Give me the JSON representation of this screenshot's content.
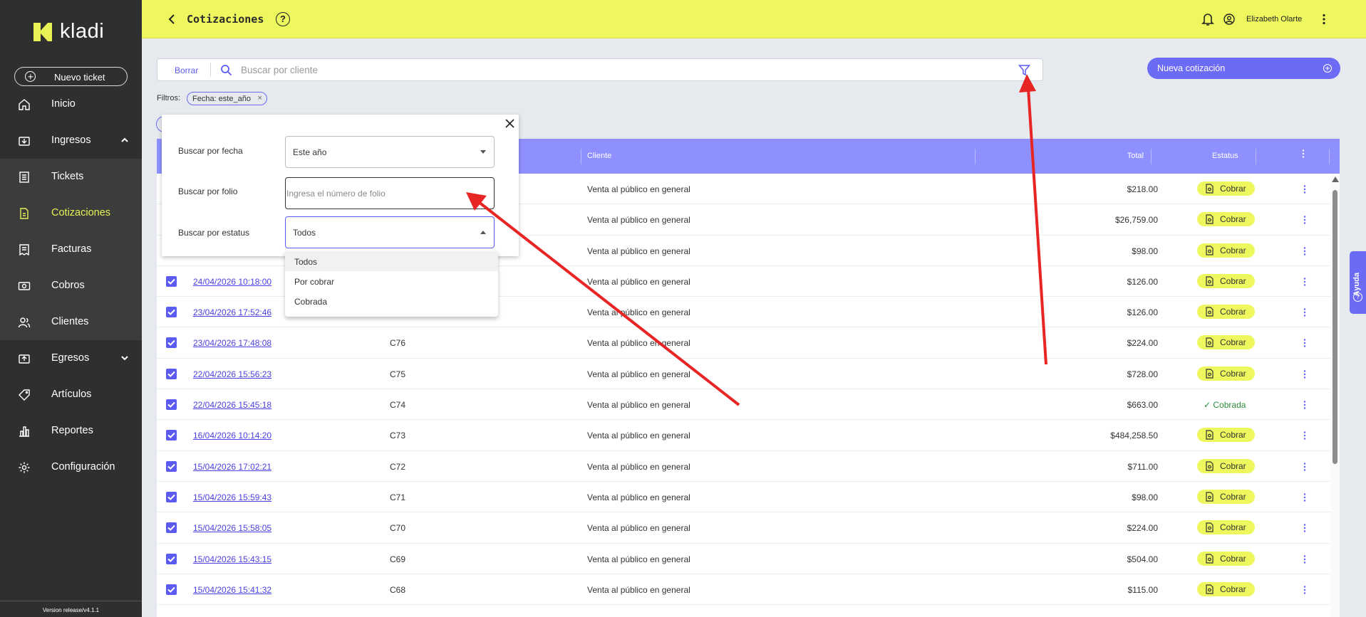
{
  "sidebar": {
    "logo_text": "kladi",
    "new_ticket_label": "Nuevo ticket",
    "items": [
      {
        "label": "Inicio",
        "icon": "home-icon"
      },
      {
        "label": "Ingresos",
        "icon": "income-icon",
        "expanded": true
      },
      {
        "label": "Tickets",
        "icon": "ticket-icon"
      },
      {
        "label": "Cotizaciones",
        "icon": "quote-icon",
        "active": true
      },
      {
        "label": "Facturas",
        "icon": "invoice-icon"
      },
      {
        "label": "Cobros",
        "icon": "money-icon"
      },
      {
        "label": "Clientes",
        "icon": "users-icon"
      },
      {
        "label": "Egresos",
        "icon": "expense-icon",
        "expanded": false
      },
      {
        "label": "Artículos",
        "icon": "tag-icon"
      },
      {
        "label": "Reportes",
        "icon": "chart-icon"
      },
      {
        "label": "Configuración",
        "icon": "gear-icon"
      }
    ],
    "version": "Version release/v4.1.1"
  },
  "header": {
    "title": "Cotizaciones",
    "help_glyph": "?",
    "user_name": "Elizabeth Olarte"
  },
  "search": {
    "clear_label": "Borrar",
    "placeholder": "Buscar por cliente"
  },
  "new_quote_label": "Nueva cotización",
  "filters": {
    "label": "Filtros:",
    "chips": [
      "Fecha: este_año"
    ],
    "chip_remove": "×"
  },
  "table": {
    "columns": {
      "client": "Cliente",
      "total": "Total",
      "status": "Estatus"
    },
    "rows": [
      {
        "date": "",
        "folio": "",
        "client": "Venta al público en general",
        "total": "$218.00",
        "status": "Cobrar"
      },
      {
        "date": "",
        "folio": "",
        "client": "Venta al público en general",
        "total": "$26,759.00",
        "status": "Cobrar"
      },
      {
        "date": "",
        "folio": "",
        "client": "Venta al público en general",
        "total": "$98.00",
        "status": "Cobrar"
      },
      {
        "date": "24/04/2026  10:18:00",
        "folio": "",
        "client": "Venta al público en general",
        "total": "$126.00",
        "status": "Cobrar"
      },
      {
        "date": "23/04/2026  17:52:46",
        "folio": "",
        "client": "Venta al público en general",
        "total": "$126.00",
        "status": "Cobrar"
      },
      {
        "date": "23/04/2026  17:48:08",
        "folio": "C76",
        "client": "Venta al público en general",
        "total": "$224.00",
        "status": "Cobrar"
      },
      {
        "date": "22/04/2026  15:56:23",
        "folio": "C75",
        "client": "Venta al público en general",
        "total": "$728.00",
        "status": "Cobrar"
      },
      {
        "date": "22/04/2026  15:45:18",
        "folio": "C74",
        "client": "Venta al público en general",
        "total": "$663.00",
        "status": "Cobrada"
      },
      {
        "date": "16/04/2026  10:14:20",
        "folio": "C73",
        "client": "Venta al público en general",
        "total": "$484,258.50",
        "status": "Cobrar"
      },
      {
        "date": "15/04/2026  17:02:21",
        "folio": "C72",
        "client": "Venta al público en general",
        "total": "$711.00",
        "status": "Cobrar"
      },
      {
        "date": "15/04/2026  15:59:43",
        "folio": "C71",
        "client": "Venta al público en general",
        "total": "$98.00",
        "status": "Cobrar"
      },
      {
        "date": "15/04/2026  15:58:05",
        "folio": "C70",
        "client": "Venta al público en general",
        "total": "$224.00",
        "status": "Cobrar"
      },
      {
        "date": "15/04/2026  15:43:15",
        "folio": "C69",
        "client": "Venta al público en general",
        "total": "$504.00",
        "status": "Cobrar"
      },
      {
        "date": "15/04/2026  15:41:32",
        "folio": "C68",
        "client": "Venta al público en general",
        "total": "$115.00",
        "status": "Cobrar"
      }
    ]
  },
  "filter_popup": {
    "date_label": "Buscar por fecha",
    "date_value": "Este año",
    "folio_label": "Buscar por folio",
    "folio_placeholder": "Ingresa el número de folio",
    "status_label": "Buscar por estatus",
    "status_value": "Todos",
    "status_options": [
      "Todos",
      "Por cobrar",
      "Cobrada"
    ]
  },
  "help_tab_label": "Ayuda",
  "colors": {
    "header_bg": "#eef85e",
    "sidebar_bg": "#2f2f2f",
    "accent": "#6b6bf5",
    "table_header": "#8f90ff",
    "active_nav": "#e8f255",
    "annotation_arrow": "#e82525"
  }
}
